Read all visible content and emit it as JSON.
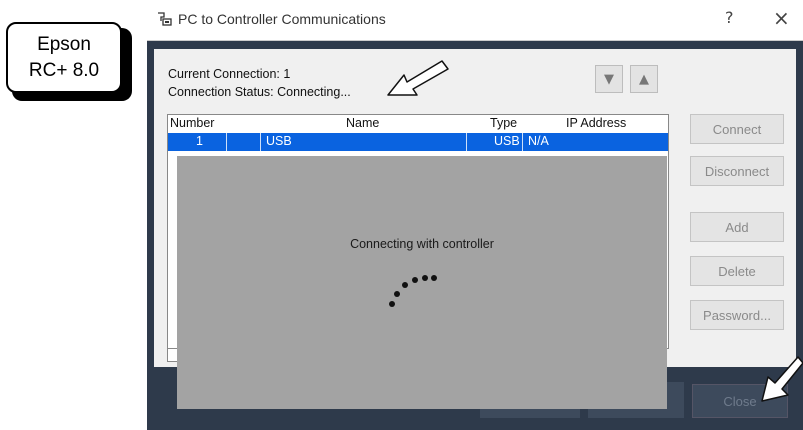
{
  "callout": {
    "line1": "Epson",
    "line2": "RC+ 8.0"
  },
  "dialog": {
    "title": "PC to Controller Communications",
    "help_label": "?",
    "close_label": "×",
    "current_connection": "Current Connection: 1",
    "connection_status": "Connection Status: Connecting...",
    "move_down_label": "▼",
    "move_up_label": "▲",
    "table": {
      "columns": [
        "Number",
        "Name",
        "Type",
        "IP Address"
      ],
      "rows": [
        {
          "number": "1",
          "name": "USB",
          "type": "USB",
          "ip": "N/A"
        }
      ]
    },
    "buttons": {
      "connect": "Connect",
      "disconnect": "Disconnect",
      "add": "Add",
      "delete": "Delete",
      "password": "Password...",
      "close": "Close"
    }
  },
  "overlay": {
    "message": "Connecting with controller"
  },
  "colors": {
    "selection": "#0a63e0",
    "dialog_frame": "#2e3a4b",
    "overlay": "#a3a3a3"
  }
}
